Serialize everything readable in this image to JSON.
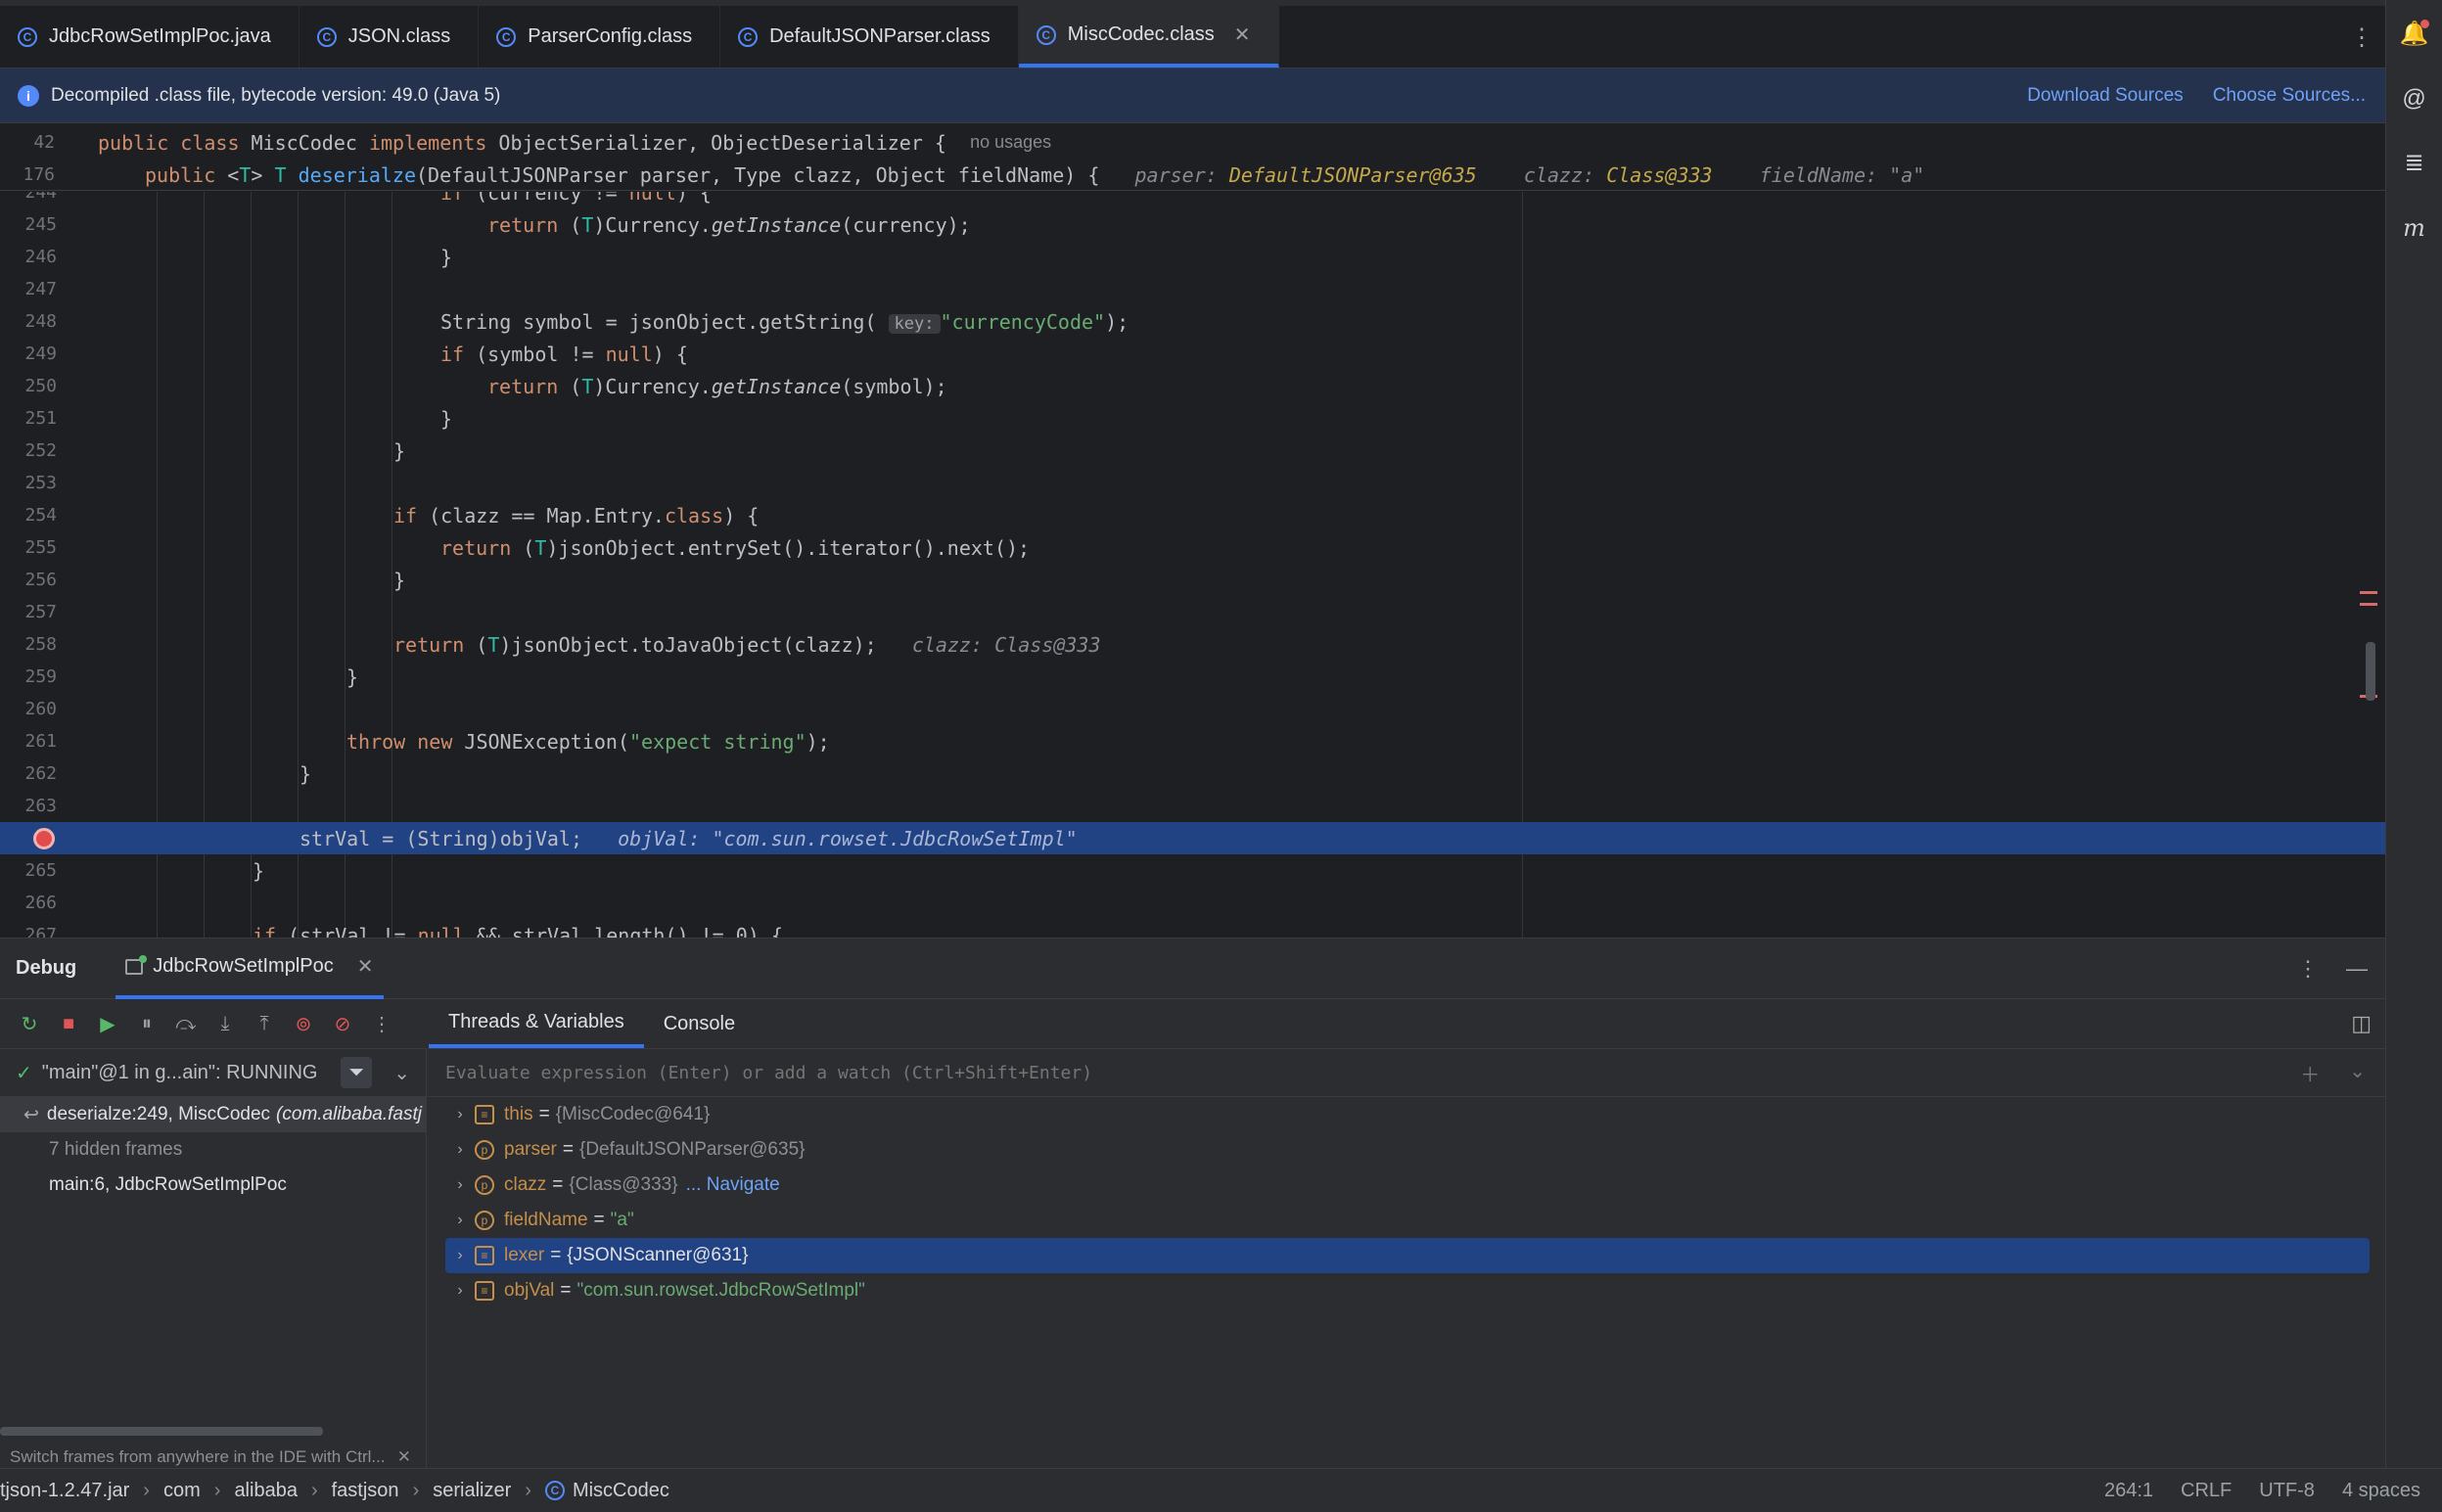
{
  "tabs": [
    {
      "label": "JdbcRowSetImplPoc.java",
      "active": false
    },
    {
      "label": "JSON.class",
      "active": false
    },
    {
      "label": "ParserConfig.class",
      "active": false
    },
    {
      "label": "DefaultJSONParser.class",
      "active": false
    },
    {
      "label": "MiscCodec.class",
      "active": true
    }
  ],
  "banner": {
    "text": "Decompiled .class file, bytecode version: 49.0 (Java 5)",
    "download_sources": "Download Sources",
    "choose_sources": "Choose Sources..."
  },
  "sticky": {
    "line1_num": "42",
    "line1_hint": "no usages",
    "line2_num": "176",
    "line2_hint_parser_label": "parser:",
    "line2_hint_parser_val": "DefaultJSONParser@635",
    "line2_hint_clazz_label": "clazz:",
    "line2_hint_clazz_val": "Class@333",
    "line2_hint_field_label": "fieldName:",
    "line2_hint_field_val": "\"a\""
  },
  "editor": {
    "line_numbers": [
      "244",
      "245",
      "246",
      "247",
      "248",
      "249",
      "250",
      "251",
      "252",
      "253",
      "254",
      "255",
      "256",
      "257",
      "258",
      "259",
      "260",
      "261",
      "262",
      "263",
      "",
      "265",
      "266",
      "267"
    ],
    "key_chip": "key:",
    "hint_clazz": "clazz: Class@333",
    "hint_objval": "objVal: \"com.sun.rowset.JdbcRowSetImpl\""
  },
  "debug": {
    "title": "Debug",
    "session": "JdbcRowSetImplPoc",
    "tab_threads": "Threads & Variables",
    "tab_console": "Console",
    "thread": "\"main\"@1 in g...ain\": RUNNING",
    "frames": [
      {
        "label": "deserialze:249, MiscCodec",
        "pkg": "(com.alibaba.fastj"
      },
      {
        "label": "7 hidden frames",
        "pkg": ""
      },
      {
        "label": "main:6, JdbcRowSetImplPoc",
        "pkg": ""
      }
    ],
    "frames_tip": "Switch frames from anywhere in the IDE with Ctrl...",
    "eval_placeholder": "Evaluate expression (Enter) or add a watch (Ctrl+Shift+Enter)",
    "variables": [
      {
        "name": "this",
        "value": "{MiscCodec@641}",
        "kind": "field",
        "string": false,
        "link": ""
      },
      {
        "name": "parser",
        "value": "{DefaultJSONParser@635}",
        "kind": "param",
        "string": false,
        "link": ""
      },
      {
        "name": "clazz",
        "value": "{Class@333}",
        "kind": "param",
        "string": false,
        "link": "... Navigate"
      },
      {
        "name": "fieldName",
        "value": "\"a\"",
        "kind": "param",
        "string": true,
        "link": ""
      },
      {
        "name": "lexer",
        "value": "{JSONScanner@631}",
        "kind": "field",
        "string": false,
        "link": ""
      },
      {
        "name": "objVal",
        "value": "\"com.sun.rowset.JdbcRowSetImpl\"",
        "kind": "field",
        "string": true,
        "link": ""
      }
    ]
  },
  "status": {
    "crumbs": [
      "tjson-1.2.47.jar",
      "com",
      "alibaba",
      "fastjson",
      "serializer",
      "MiscCodec"
    ],
    "position": "264:1",
    "line_sep": "CRLF",
    "encoding": "UTF-8",
    "indent": "4 spaces"
  },
  "colors": {
    "accent": "#3574f0",
    "selection": "#214283",
    "breakpoint": "#e04c4c"
  }
}
